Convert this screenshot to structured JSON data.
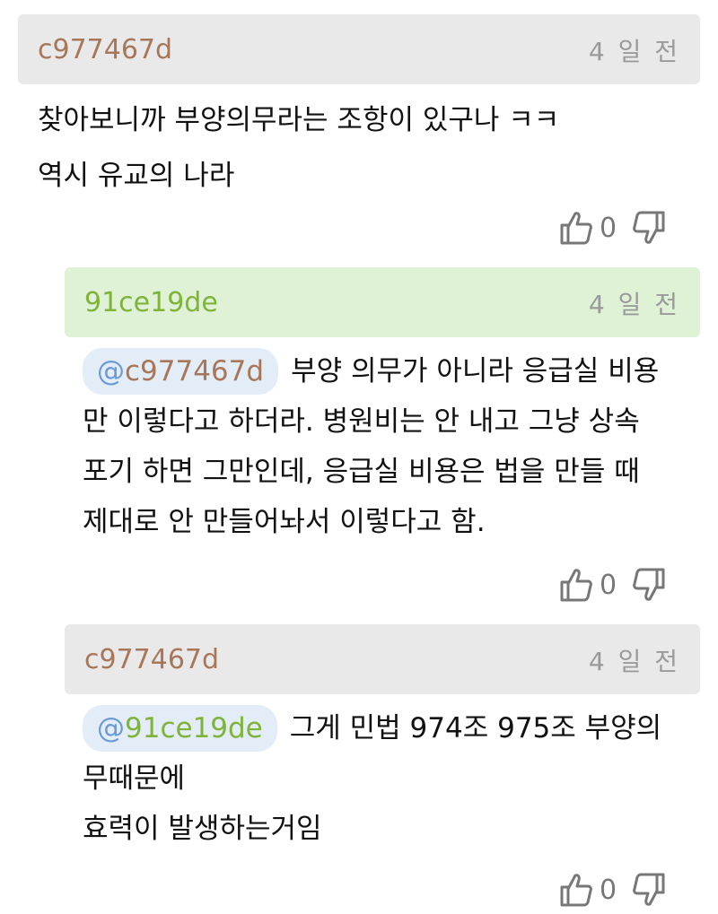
{
  "colors": {
    "username_brown": "#a8775a",
    "username_green": "#7fb33a",
    "header_gray": "#e9e9e9",
    "header_green": "#dff2d6",
    "mention_bg": "#e3edf8",
    "mention_at": "#6a9bd4"
  },
  "comments": [
    {
      "user": "c977467d",
      "time": "4 일 전",
      "lines": [
        "찾아보니까 부양의무라는 조항이 있구나 ㅋㅋ",
        "역시 유교의 나라"
      ],
      "likes": "0",
      "like_icon": "thumbs-up-icon",
      "dislike_icon": "thumbs-down-icon"
    },
    {
      "user": "91ce19de",
      "time": "4 일 전",
      "mention": "c977467d",
      "first_line": "부양 의무가 아니라 응급실 비용",
      "lines": [
        "만 이렇다고 하더라. 병원비는 안 내고 그냥 상속",
        "포기 하면 그만인데, 응급실 비용은 법을 만들 때",
        "제대로 안 만들어놔서 이렇다고 함."
      ],
      "likes": "0"
    },
    {
      "user": "c977467d",
      "time": "4 일 전",
      "mention": "91ce19de",
      "first_line": "그게 민법 974조 975조 부양의",
      "lines": [
        "무때문에",
        "효력이 발생하는거임"
      ],
      "likes": "0"
    }
  ]
}
